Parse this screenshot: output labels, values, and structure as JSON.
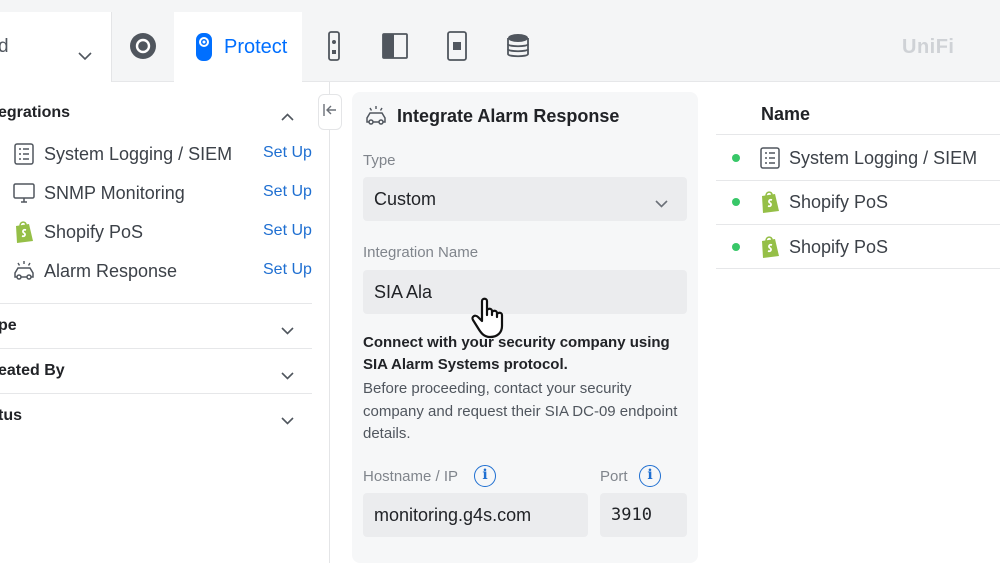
{
  "topbar": {
    "site_value": "d",
    "active_app": "Protect",
    "brand": "UniFi",
    "icons": [
      "chevron-down-icon",
      "network-circle-icon",
      "protect-camera-icon",
      "access-reader-icon",
      "door-panel-icon",
      "intercom-icon",
      "storage-stack-icon"
    ]
  },
  "sidebar": {
    "integrations_title": "egrations",
    "items": [
      {
        "icon": "log-list-icon",
        "label": "System Logging / SIEM",
        "action": "Set Up"
      },
      {
        "icon": "monitor-icon",
        "label": "SNMP Monitoring",
        "action": "Set Up"
      },
      {
        "icon": "shopify-icon",
        "label": "Shopify PoS",
        "action": "Set Up"
      },
      {
        "icon": "alarm-car-icon",
        "label": "Alarm Response",
        "action": "Set Up"
      }
    ],
    "filters": [
      {
        "label": "pe"
      },
      {
        "label": "eated By"
      },
      {
        "label": "tus"
      }
    ]
  },
  "form": {
    "title": "Integrate Alarm Response",
    "type_label": "Type",
    "type_value": "Custom",
    "name_label": "Integration Name",
    "name_value": "SIA Ala",
    "desc_bold": "Connect with your security company using SIA Alarm Systems protocol.",
    "desc": "Before proceeding, contact your security company and request their SIA DC-09 endpoint details.",
    "hostname_label": "Hostname / IP",
    "hostname_value": "monitoring.g4s.com",
    "port_label": "Port",
    "port_value": "3910",
    "info_glyph": "i"
  },
  "list": {
    "column_name": "Name",
    "rows": [
      {
        "icon": "log-list-icon",
        "name": "System Logging / SIEM",
        "status": "active"
      },
      {
        "icon": "shopify-icon",
        "name": "Shopify PoS",
        "status": "active"
      },
      {
        "icon": "shopify-icon",
        "name": "Shopify PoS",
        "status": "active"
      }
    ]
  },
  "colors": {
    "accent": "#006fff",
    "link": "#1f6fd1",
    "status_ok": "#38c768",
    "shopify": "#95bf47"
  }
}
